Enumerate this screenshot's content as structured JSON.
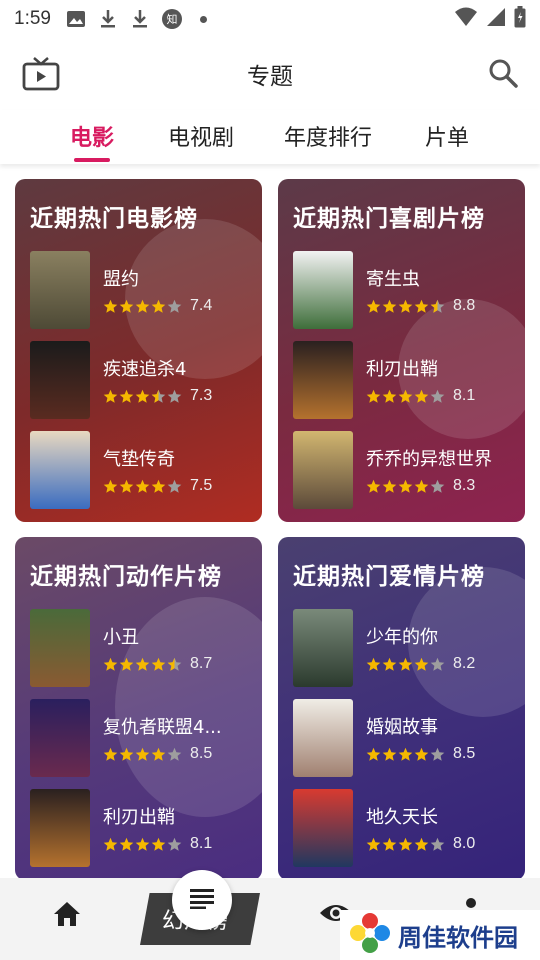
{
  "status_bar": {
    "time": "1:59",
    "icons": [
      "image-icon",
      "download-icon",
      "download-icon",
      "zhihu-icon",
      "dot-icon",
      "wifi-icon",
      "signal-icon",
      "battery-icon"
    ],
    "zhihu_char": "知"
  },
  "header": {
    "title": "专题",
    "left_icon": "tv-icon",
    "right_icon": "search-icon"
  },
  "tabs": [
    {
      "label": "电影",
      "active": true
    },
    {
      "label": "电视剧",
      "active": false
    },
    {
      "label": "年度排行",
      "active": false
    },
    {
      "label": "片单",
      "active": false
    }
  ],
  "colors": {
    "accent": "#d81b60",
    "star": "#f5b800",
    "star_empty": "#9e9e9e"
  },
  "cards": [
    {
      "title": "近期热门电影榜",
      "items": [
        {
          "name": "盟约",
          "rating": "7.4",
          "stars": 4
        },
        {
          "name": "疾速追杀4",
          "rating": "7.3",
          "stars": 3.5
        },
        {
          "name": "气垫传奇",
          "rating": "7.5",
          "stars": 4
        }
      ]
    },
    {
      "title": "近期热门喜剧片榜",
      "items": [
        {
          "name": "寄生虫",
          "rating": "8.8",
          "stars": 4.5
        },
        {
          "name": "利刃出鞘",
          "rating": "8.1",
          "stars": 4
        },
        {
          "name": "乔乔的异想世界",
          "rating": "8.3",
          "stars": 4
        }
      ]
    },
    {
      "title": "近期热门动作片榜",
      "items": [
        {
          "name": "小丑",
          "rating": "8.7",
          "stars": 4.5
        },
        {
          "name": "复仇者联盟4...",
          "rating": "8.5",
          "stars": 4
        },
        {
          "name": "利刃出鞘",
          "rating": "8.1",
          "stars": 4
        }
      ]
    },
    {
      "title": "近期热门爱情片榜",
      "items": [
        {
          "name": "少年的你",
          "rating": "8.2",
          "stars": 4
        },
        {
          "name": "婚姻故事",
          "rating": "8.5",
          "stars": 4
        },
        {
          "name": "地久天长",
          "rating": "8.0",
          "stars": 4
        }
      ]
    }
  ],
  "bottom_nav": {
    "home_icon": "home-icon",
    "center_icon": "list-icon",
    "chip_label": "幻片榜",
    "eye_icon": "eye-icon"
  },
  "watermark": {
    "text": "周佳软件园"
  }
}
